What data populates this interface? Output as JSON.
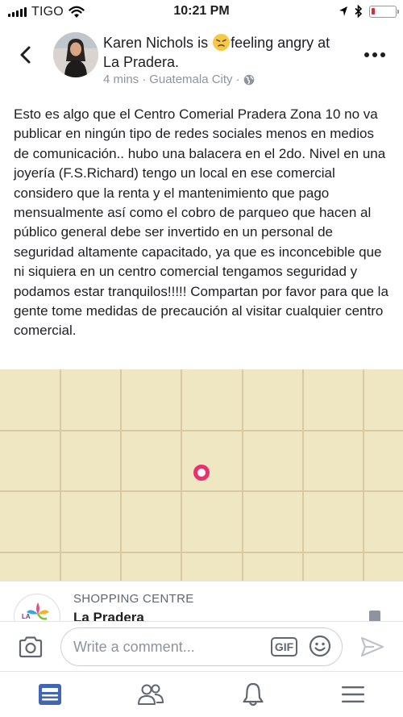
{
  "status_bar": {
    "carrier": "TIGO",
    "time": "10:21 PM",
    "battery_level": 0.15,
    "colors": {
      "battery_low": "#e0282e"
    }
  },
  "post": {
    "author": "Karen Nichols",
    "status_text_1": "is",
    "feeling_emoji": "angry-face-icon",
    "status_text_2": "feeling angry at",
    "place": "La Pradera.",
    "time_ago": "4 mins",
    "separator": "·",
    "location": "Guatemala City",
    "privacy_icon": "globe-icon",
    "body": "Esto es algo que el Centro Comerial Pradera Zona 10 no va publicar en ningún tipo de redes sociales menos en medios de comunicación.. hubo una balacera en el 2do. Nivel en una joyería (F.S.Richard) tengo un local en ese comercial considero que la renta y el mantenimiento que pago mensualmente así como el cobro de parqueo que hacen al público general debe ser invertido en un personal de seguridad altamente capacitado, ya que es inconcebible que ni siquiera en un centro comercial tengamos seguridad y podamos estar tranquilos!!!!! Compartan por favor para que la gente tome medidas de precaución al visitar cualquier centro comercial."
  },
  "place_card": {
    "category": "SHOPPING CENTRE",
    "name": "La Pradera",
    "logo_text": "LA"
  },
  "comment_bar": {
    "placeholder": "Write a comment...",
    "gif_label": "GIF"
  },
  "tabs": [
    {
      "icon": "news-feed-icon",
      "active": true
    },
    {
      "icon": "friends-icon",
      "active": false
    },
    {
      "icon": "notifications-bell-icon",
      "active": false
    },
    {
      "icon": "menu-icon",
      "active": false
    }
  ],
  "colors": {
    "accent": "#4267b2",
    "map_background": "#efe6c2",
    "map_pin": "#e8326f",
    "text_secondary": "#8d949e"
  }
}
